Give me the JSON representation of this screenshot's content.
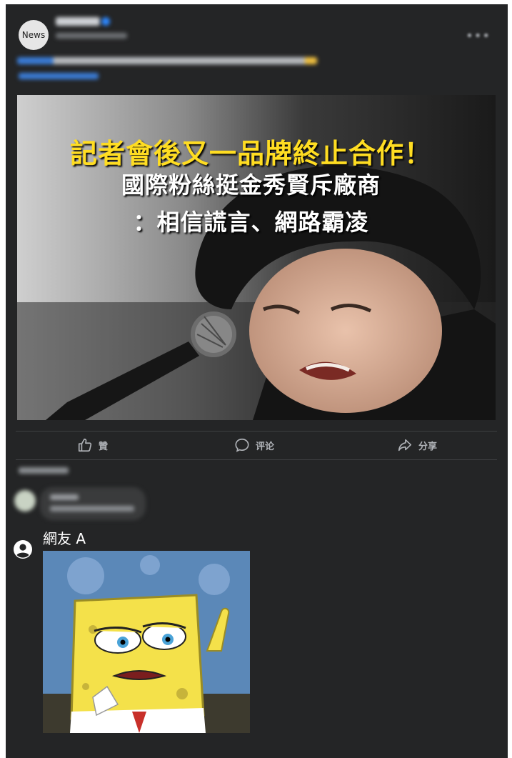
{
  "post": {
    "avatar_text": "News",
    "image_headline": {
      "line1": "記者會後又一品牌終止合作！",
      "line2": "國際粉絲挺金秀賢斥廠商",
      "line3": "：相信謊言、網路霸凌"
    }
  },
  "actions": {
    "like": "贊",
    "comment": "评论",
    "share": "分享"
  },
  "comment_reply": {
    "username": "網友 A"
  },
  "colors": {
    "card_bg": "#242526",
    "headline_yellow": "#ffdd22",
    "action_text": "#b0b3b8"
  }
}
